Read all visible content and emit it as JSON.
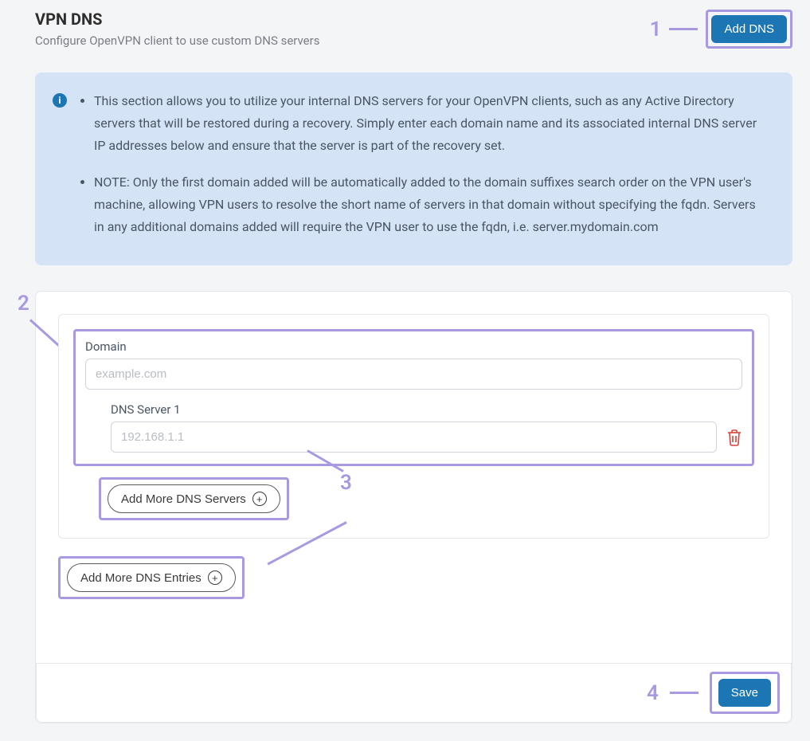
{
  "header": {
    "title": "VPN DNS",
    "subtitle": "Configure OpenVPN client to use custom DNS servers",
    "add_dns_label": "Add DNS"
  },
  "callouts": {
    "c1": "1",
    "c2": "2",
    "c3": "3",
    "c4": "4"
  },
  "info": {
    "bullet1": "This section allows you to utilize your internal DNS servers for your OpenVPN clients, such as any Active Directory servers that will be restored during a recovery. Simply enter each domain name and its associated internal DNS server IP addresses below and ensure that the server is part of the recovery set.",
    "bullet2": "NOTE: Only the first domain added will be automatically added to the domain suffixes search order on the VPN user's machine, allowing VPN users to resolve the short name of servers in that domain without specifying the fqdn. Servers in any additional domains added will require the VPN user to use the fqdn, i.e. server.mydomain.com"
  },
  "form": {
    "domain_label": "Domain",
    "domain_placeholder": "example.com",
    "domain_value": "",
    "dns_server_label": "DNS Server 1",
    "dns_server_placeholder": "192.168.1.1",
    "dns_server_value": "",
    "add_more_servers_label": "Add More DNS Servers",
    "add_more_entries_label": "Add More DNS Entries"
  },
  "footer": {
    "save_label": "Save"
  }
}
